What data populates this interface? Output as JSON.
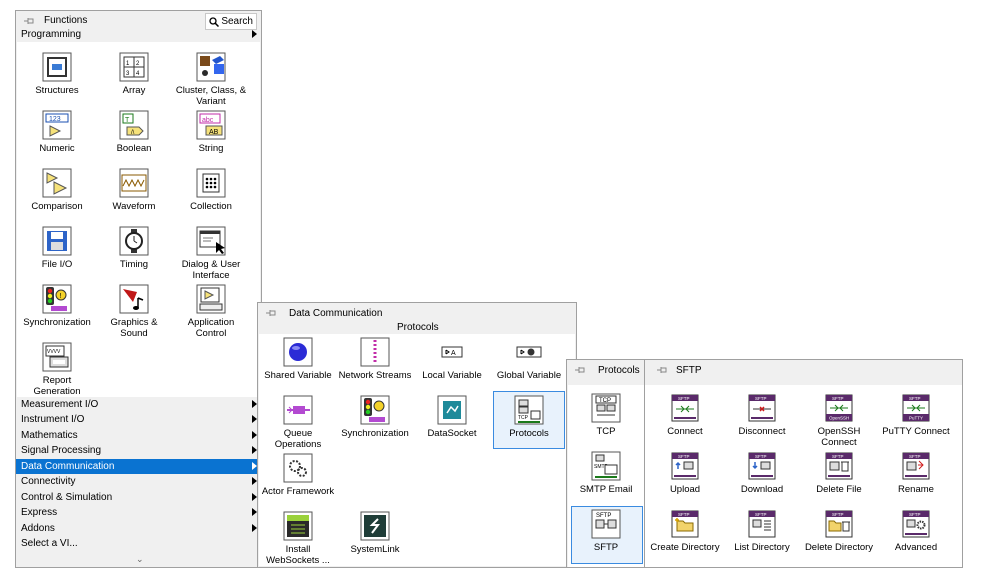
{
  "functions": {
    "title": "Functions",
    "search_label": "Search",
    "top_category": "Programming",
    "items": [
      {
        "label": "Structures",
        "icon": "structures-icon"
      },
      {
        "label": "Array",
        "icon": "array-icon"
      },
      {
        "label": "Cluster, Class, & Variant",
        "icon": "cluster-icon"
      },
      {
        "label": "Numeric",
        "icon": "numeric-icon"
      },
      {
        "label": "Boolean",
        "icon": "boolean-icon"
      },
      {
        "label": "String",
        "icon": "string-icon"
      },
      {
        "label": "Comparison",
        "icon": "comparison-icon"
      },
      {
        "label": "Waveform",
        "icon": "waveform-icon"
      },
      {
        "label": "Collection",
        "icon": "collection-icon"
      },
      {
        "label": "File I/O",
        "icon": "file-io-icon"
      },
      {
        "label": "Timing",
        "icon": "timing-icon"
      },
      {
        "label": "Dialog & User Interface",
        "icon": "dialog-icon"
      },
      {
        "label": "Synchronization",
        "icon": "synchronization-icon"
      },
      {
        "label": "Graphics & Sound",
        "icon": "graphics-icon"
      },
      {
        "label": "Application Control",
        "icon": "app-control-icon"
      },
      {
        "label": "Report Generation",
        "icon": "report-icon"
      }
    ],
    "categories": [
      {
        "label": "Measurement I/O"
      },
      {
        "label": "Instrument I/O"
      },
      {
        "label": "Mathematics"
      },
      {
        "label": "Signal Processing"
      },
      {
        "label": "Data Communication",
        "selected": true
      },
      {
        "label": "Connectivity"
      },
      {
        "label": "Control & Simulation"
      },
      {
        "label": "Express"
      },
      {
        "label": "Addons"
      },
      {
        "label": "Select a VI...",
        "no_arrow": true
      }
    ],
    "expand_glyph": "⌄"
  },
  "data_communication": {
    "title": "Data Communication",
    "subheader": "Protocols",
    "items": [
      {
        "label": "Shared Variable",
        "icon": "shared-variable-icon"
      },
      {
        "label": "Network Streams",
        "icon": "network-streams-icon"
      },
      {
        "label": "Local Variable",
        "icon": "local-variable-icon"
      },
      {
        "label": "Global Variable",
        "icon": "global-variable-icon"
      },
      {
        "label": "Queue Operations",
        "icon": "queue-icon"
      },
      {
        "label": "Synchronization",
        "icon": "synchronization-icon"
      },
      {
        "label": "DataSocket",
        "icon": "datasocket-icon"
      },
      {
        "label": "Protocols",
        "icon": "protocols-icon",
        "selected": true
      },
      {
        "label": "Actor Framework",
        "icon": "actor-framework-icon"
      },
      {
        "label": "Install WebSockets ...",
        "icon": "websockets-icon"
      },
      {
        "label": "SystemLink",
        "icon": "systemlink-icon"
      }
    ]
  },
  "protocols": {
    "title": "Protocols",
    "items": [
      {
        "label": "TCP",
        "icon": "tcp-icon"
      },
      {
        "label": "SMTP Email",
        "icon": "smtp-icon"
      },
      {
        "label": "SFTP",
        "icon": "sftp-icon",
        "selected": true
      }
    ]
  },
  "sftp": {
    "title": "SFTP",
    "items": [
      {
        "label": "Connect",
        "icon": "sftp-connect-icon"
      },
      {
        "label": "Disconnect",
        "icon": "sftp-disconnect-icon"
      },
      {
        "label": "OpenSSH Connect",
        "icon": "openssh-connect-icon"
      },
      {
        "label": "PuTTY Connect",
        "icon": "putty-connect-icon"
      },
      {
        "label": "Upload",
        "icon": "upload-icon"
      },
      {
        "label": "Download",
        "icon": "download-icon"
      },
      {
        "label": "Delete File",
        "icon": "delete-file-icon"
      },
      {
        "label": "Rename",
        "icon": "rename-icon"
      },
      {
        "label": "Create Directory",
        "icon": "create-directory-icon"
      },
      {
        "label": "List Directory",
        "icon": "list-directory-icon"
      },
      {
        "label": "Delete Directory",
        "icon": "delete-directory-icon"
      },
      {
        "label": "Advanced",
        "icon": "advanced-icon"
      }
    ]
  }
}
